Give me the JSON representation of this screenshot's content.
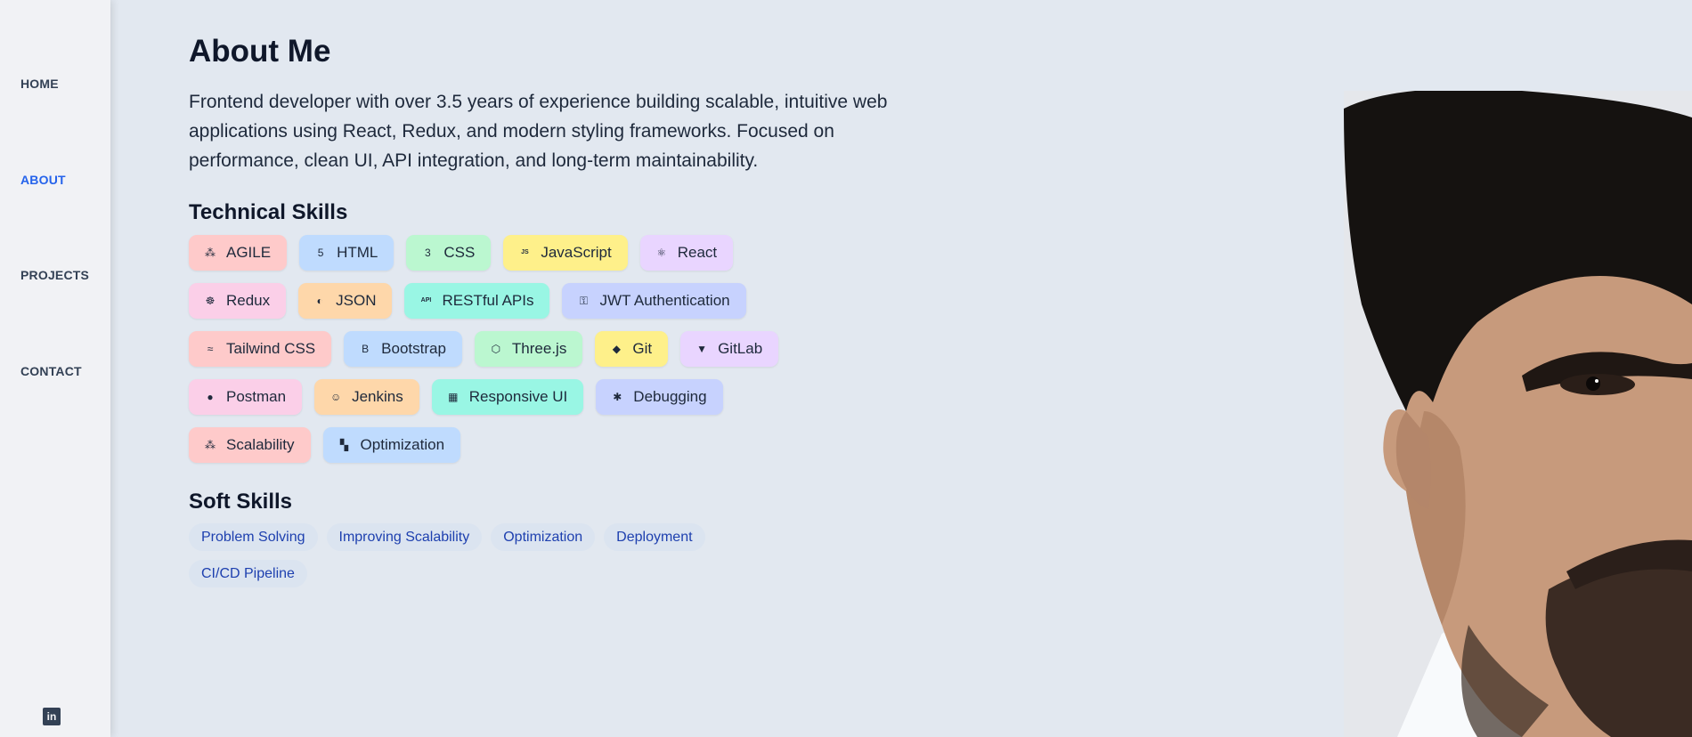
{
  "sidebar": {
    "items": [
      {
        "label": "HOME",
        "active": false
      },
      {
        "label": "ABOUT",
        "active": true
      },
      {
        "label": "PROJECTS",
        "active": false
      },
      {
        "label": "CONTACT",
        "active": false
      }
    ],
    "social_icon": "linkedin-icon",
    "social_glyph": "in"
  },
  "about": {
    "title": "About Me",
    "intro": "Frontend developer with over 3.5 years of experience building scalable, intuitive web applications using React, Redux, and modern styling frameworks. Focused on performance, clean UI, API integration, and long-term maintainability."
  },
  "technical_skills": {
    "heading": "Technical Skills",
    "items": [
      {
        "label": "AGILE",
        "icon": "sitemap-icon",
        "glyph": "⁂",
        "color": "#fecaca"
      },
      {
        "label": "HTML",
        "icon": "html5-icon",
        "glyph": "5",
        "color": "#bfdbfe"
      },
      {
        "label": "CSS",
        "icon": "css3-icon",
        "glyph": "3",
        "color": "#bbf7d0"
      },
      {
        "label": "JavaScript",
        "icon": "javascript-icon",
        "glyph": "JS",
        "color": "#fef08a"
      },
      {
        "label": "React",
        "icon": "react-icon",
        "glyph": "⚛",
        "color": "#e9d5ff"
      },
      {
        "label": "Redux",
        "icon": "redux-icon",
        "glyph": "☸",
        "color": "#fbcfe8"
      },
      {
        "label": "JSON",
        "icon": "json-icon",
        "glyph": "◐",
        "color": "#fed7aa"
      },
      {
        "label": "RESTful APIs",
        "icon": "api-icon",
        "glyph": "API",
        "color": "#99f6e4"
      },
      {
        "label": "JWT Authentication",
        "icon": "key-icon",
        "glyph": "⚿",
        "color": "#c7d2fe"
      },
      {
        "label": "Tailwind CSS",
        "icon": "tailwind-icon",
        "glyph": "≈",
        "color": "#fecaca"
      },
      {
        "label": "Bootstrap",
        "icon": "bootstrap-icon",
        "glyph": "B",
        "color": "#bfdbfe"
      },
      {
        "label": "Three.js",
        "icon": "cube-icon",
        "glyph": "⬡",
        "color": "#bbf7d0"
      },
      {
        "label": "Git",
        "icon": "git-icon",
        "glyph": "◆",
        "color": "#fef08a"
      },
      {
        "label": "GitLab",
        "icon": "gitlab-icon",
        "glyph": "▼",
        "color": "#e9d5ff"
      },
      {
        "label": "Postman",
        "icon": "postman-icon",
        "glyph": "●",
        "color": "#fbcfe8"
      },
      {
        "label": "Jenkins",
        "icon": "jenkins-icon",
        "glyph": "☺",
        "color": "#fed7aa"
      },
      {
        "label": "Responsive UI",
        "icon": "grid-icon",
        "glyph": "▦",
        "color": "#99f6e4"
      },
      {
        "label": "Debugging",
        "icon": "bug-icon",
        "glyph": "✱",
        "color": "#c7d2fe"
      },
      {
        "label": "Scalability",
        "icon": "nodes-icon",
        "glyph": "⁂",
        "color": "#fecaca"
      },
      {
        "label": "Optimization",
        "icon": "dashboard-icon",
        "glyph": "▚",
        "color": "#bfdbfe"
      }
    ]
  },
  "soft_skills": {
    "heading": "Soft Skills",
    "items": [
      "Problem Solving",
      "Improving Scalability",
      "Optimization",
      "Deployment",
      "CI/CD Pipeline"
    ]
  },
  "portrait": {
    "subject": "profile-photo"
  }
}
